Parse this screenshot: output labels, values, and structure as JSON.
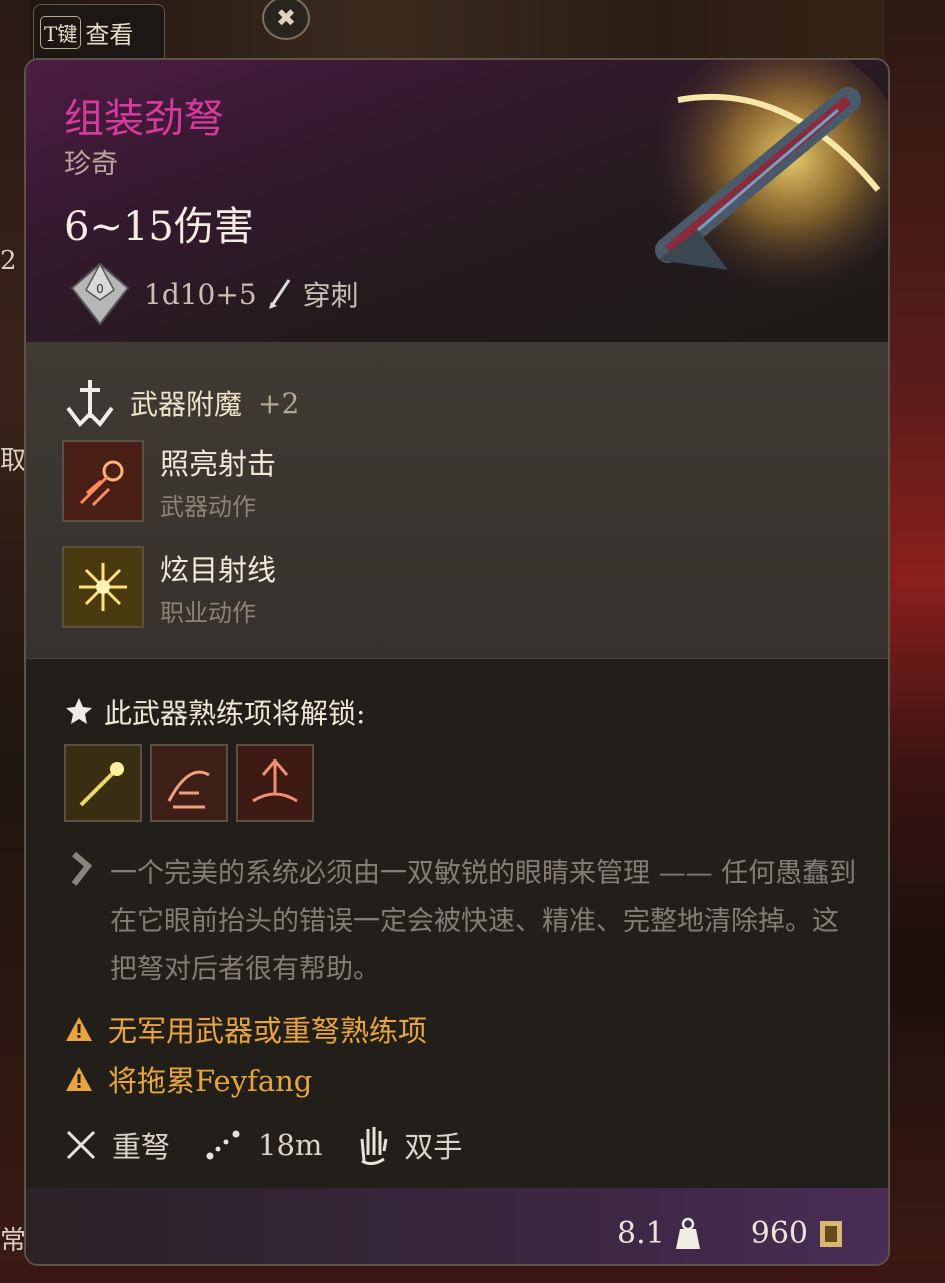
{
  "inspect": {
    "key": "T键",
    "label": "查看"
  },
  "close": {
    "glyph": "✖"
  },
  "side_fragments": [
    "2",
    "取",
    "常"
  ],
  "item": {
    "name": "组装劲弩",
    "rarity": "珍奇",
    "damage_range": "6~15伤害",
    "damage_dice": "1d10+5",
    "damage_type": "穿刺",
    "name_color": "#d63a9c"
  },
  "enchantment": {
    "label": "武器附魔",
    "bonus": "+2"
  },
  "actions": [
    {
      "name": "照亮射击",
      "type": "武器动作",
      "icon": "illuminated-shot-icon"
    },
    {
      "name": "炫目射线",
      "type": "职业动作",
      "icon": "dazzling-ray-icon"
    }
  ],
  "proficiency": {
    "title": "此武器熟练项将解锁:",
    "icons": [
      "piercing-shot-icon",
      "mobile-shot-icon",
      "brace-icon"
    ]
  },
  "description": "一个完美的系统必须由一双敏锐的眼睛来管理 —— 任何愚蠢到在它眼前抬头的错误一定会被快速、精准、完整地清除掉。这把弩对后者很有帮助。",
  "warnings": [
    "无军用武器或重弩熟练项",
    "将拖累Feyfang"
  ],
  "stats": {
    "weapon_type": "重弩",
    "range": "18m",
    "handedness": "双手"
  },
  "footer": {
    "weight": "8.1",
    "value": "960"
  },
  "colors": {
    "warning": "#e9a43e",
    "accent": "#d63a9c"
  }
}
